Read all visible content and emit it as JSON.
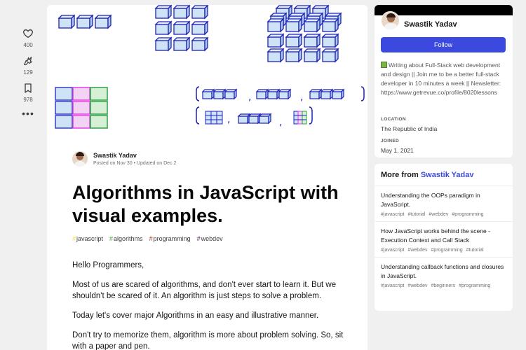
{
  "reactions": [
    {
      "icon": "heart-icon",
      "count": "400"
    },
    {
      "icon": "unicorn-icon",
      "count": "129"
    },
    {
      "icon": "bookmark-icon",
      "count": "978"
    }
  ],
  "more_icon": "ellipsis-icon",
  "article": {
    "author": "Swastik Yadav",
    "date": "Posted on Nov 30 • Updated on Dec 2",
    "title": "Algorithms in JavaScript with visual examples.",
    "tags": [
      {
        "name": "javascript",
        "color": "#efdf3d"
      },
      {
        "name": "algorithms",
        "color": "#3ea335"
      },
      {
        "name": "programming",
        "color": "#a53d2a"
      },
      {
        "name": "webdev",
        "color": "#562765"
      }
    ],
    "paragraphs": [
      "Hello Programmers,",
      "Most of us are scared of algorithms, and don't ever start to learn it. But we shouldn't be scared of it. An algorithm is just steps to solve a problem.",
      "Today let's cover major Algorithms in an easy and illustrative manner.",
      "Don't try to memorize them, algorithm is more about problem solving. So, sit with a paper and pen."
    ]
  },
  "profile": {
    "name": "Swastik Yadav",
    "follow_label": "Follow",
    "bio": "Writing about Full-Stack web development and design || Join me to be a better full-stack developer in 10 minutes a week || Newsletter: https://www.getrevue.co/profile/8020lessons",
    "location_label": "LOCATION",
    "location": "The Republic of India",
    "joined_label": "JOINED",
    "joined": "May 1, 2021"
  },
  "more_from": {
    "prefix": "More from",
    "author": "Swastik Yadav",
    "posts": [
      {
        "title": "Understanding the OOPs paradigm in JavaScript.",
        "tags": [
          "#javascript",
          "#tutorial",
          "#webdev",
          "#programming"
        ]
      },
      {
        "title": "How JavaScript works behind the scene - Execution Context and Call Stack",
        "tags": [
          "#javascript",
          "#webdev",
          "#programming",
          "#tutorial"
        ]
      },
      {
        "title": "Understanding callback functions and closures in JavaScript.",
        "tags": [
          "#javascript",
          "#webdev",
          "#beginners",
          "#programming"
        ]
      }
    ]
  },
  "colors": {
    "accent": "#3b49df",
    "cube_fill": "#cfe3f7",
    "cube_stroke": "#1f22b8",
    "magenta": "#e040e0",
    "green": "#2ea043"
  }
}
